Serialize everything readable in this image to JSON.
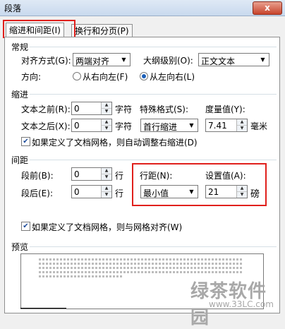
{
  "window": {
    "title": "段落",
    "close_glyph": "x"
  },
  "tabs": [
    {
      "label": "缩进和间距(I)"
    },
    {
      "label": "换行和分页(P)"
    }
  ],
  "general": {
    "section": "常规",
    "align_label": "对齐方式(G):",
    "align_value": "两端对齐",
    "outline_label": "大纲级别(O):",
    "outline_value": "正文文本",
    "direction_label": "方向:",
    "rtl_label": "从右向左(F)",
    "ltr_label": "从左向右(L)"
  },
  "indent": {
    "section": "缩进",
    "before_label": "文本之前(R):",
    "before_value": "0",
    "before_unit": "字符",
    "after_label": "文本之后(X):",
    "after_value": "0",
    "after_unit": "字符",
    "special_label": "特殊格式(S):",
    "special_value": "首行缩进",
    "measure_label": "度量值(Y):",
    "measure_value": "7.41",
    "measure_unit": "毫米",
    "grid_check_label": "如果定义了文档网格，则自动调整右缩进(D)"
  },
  "spacing": {
    "section": "间距",
    "before_label": "段前(B):",
    "before_value": "0",
    "before_unit": "行",
    "after_label": "段后(E):",
    "after_value": "0",
    "after_unit": "行",
    "line_label": "行距(N):",
    "line_value": "最小值",
    "setting_label": "设置值(A):",
    "setting_value": "21",
    "setting_unit": "磅",
    "grid_check_label": "如果定义了文档网格，则与网格对齐(W)"
  },
  "preview": {
    "section": "预览"
  },
  "watermark": {
    "text": "绿茶软件园",
    "url": "www.33LC.com"
  },
  "colors": {
    "highlight_red": "#e0201c",
    "radio_blue": "#1c5fb8"
  }
}
